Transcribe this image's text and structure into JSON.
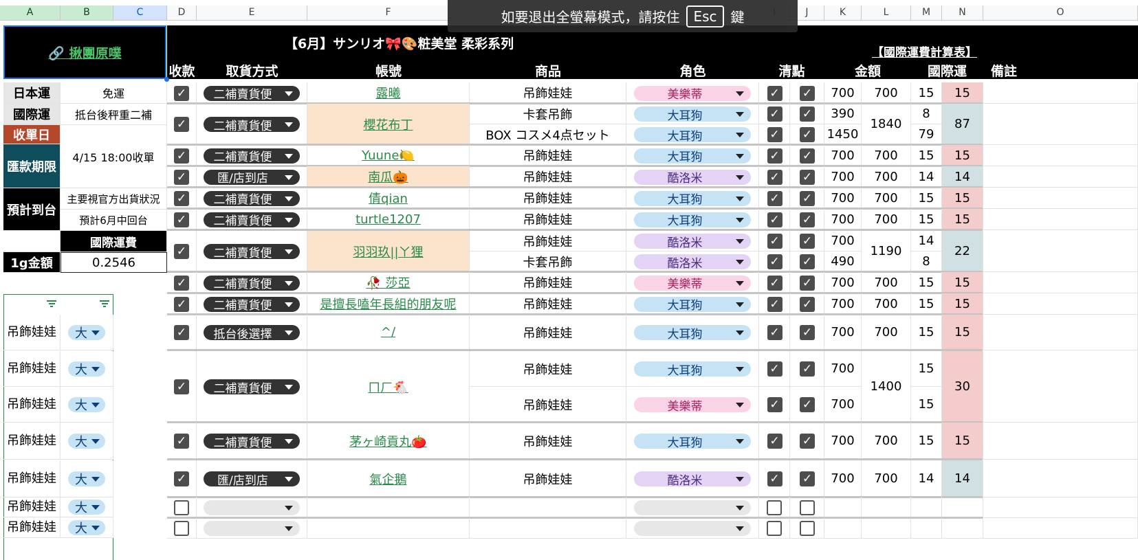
{
  "column_headers": [
    "A",
    "B",
    "C",
    "D",
    "E",
    "F",
    "G",
    "H",
    "I",
    "J",
    "K",
    "L",
    "M",
    "N",
    "O"
  ],
  "toast": {
    "text_before": "如要退出全螢幕模式，請按住",
    "key": "Esc",
    "text_after": "鍵"
  },
  "header": {
    "group_link": "🔗 揪團原噗",
    "title": "【6月】サンリオ🎀🎨粧美堂 柔彩系列",
    "calc_link": "【國際運費計算表】",
    "col_labels": {
      "payment": "收款",
      "pickup": "取貨方式",
      "account": "帳號",
      "product": "商品",
      "character": "角色",
      "check": "清點",
      "amount": "金額",
      "intl_ship": "國際運",
      "note": "備註"
    }
  },
  "info": {
    "jp_ship_label": "日本運",
    "jp_ship_value": "免運",
    "intl_ship_label": "國際運",
    "intl_ship_value": "抵台後秤重二補",
    "close_label": "收單日",
    "close_value": "4/15 18:00收單",
    "pay_label": "匯款期限",
    "arrival_label": "預計到台",
    "arrival_value1": "主要視官方出貨狀況",
    "arrival_value2": "預計6月中回台",
    "intl_fee_label": "國際運費",
    "gram_label": "1g金額",
    "gram_value": "0.2546"
  },
  "filter_rows": [
    {
      "product": "吊飾娃娃",
      "size": "大"
    },
    {
      "product": "吊飾娃娃",
      "size": "大"
    },
    {
      "product": "吊飾娃娃",
      "size": "大"
    },
    {
      "product": "吊飾娃娃",
      "size": "大"
    },
    {
      "product": "吊飾娃娃",
      "size": "大"
    },
    {
      "product": "吊飾娃娃",
      "size": "大"
    },
    {
      "product": "吊飾娃娃",
      "size": "大"
    }
  ],
  "colors": {
    "header_black": "#000000",
    "close_red": "#b5472b",
    "pay_teal": "#0f4c5c",
    "account_peach": "#fbe3cc",
    "ship_pink": "#f4cccc",
    "ship_blue": "#d0e0e3",
    "link_green": "#2a8a4a"
  },
  "orders": [
    {
      "pickup": "二補賣貨便",
      "account": "露曦",
      "account_bg": false,
      "items": [
        {
          "product": "吊飾娃娃",
          "character": "美樂蒂",
          "char_color": "pink",
          "amount": "700",
          "ship": "15"
        }
      ],
      "total": "700",
      "intl": "15",
      "intl_color": "pink"
    },
    {
      "pickup": "二補賣貨便",
      "account": "櫻花布丁",
      "account_bg": true,
      "items": [
        {
          "product": "卡套吊飾",
          "character": "大耳狗",
          "char_color": "blue",
          "amount": "390",
          "ship": "8"
        },
        {
          "product": "BOX コスメ4点セット",
          "character": "大耳狗",
          "char_color": "blue",
          "amount": "1450",
          "ship": "79"
        }
      ],
      "total": "1840",
      "intl": "87",
      "intl_color": "blue"
    },
    {
      "pickup": "二補賣貨便",
      "account": "Yuune🍋",
      "account_bg": false,
      "items": [
        {
          "product": "吊飾娃娃",
          "character": "大耳狗",
          "char_color": "blue",
          "amount": "700",
          "ship": "15"
        }
      ],
      "total": "700",
      "intl": "15",
      "intl_color": "pink"
    },
    {
      "pickup": "匯/店到店",
      "account": "南瓜🎃",
      "account_bg": true,
      "items": [
        {
          "product": "吊飾娃娃",
          "character": "酷洛米",
          "char_color": "purple",
          "amount": "700",
          "ship": "14"
        }
      ],
      "total": "700",
      "intl": "14",
      "intl_color": "blue"
    },
    {
      "pickup": "二補賣貨便",
      "account": "倩qian",
      "account_bg": false,
      "items": [
        {
          "product": "吊飾娃娃",
          "character": "大耳狗",
          "char_color": "blue",
          "amount": "700",
          "ship": "15"
        }
      ],
      "total": "700",
      "intl": "15",
      "intl_color": "pink"
    },
    {
      "pickup": "二補賣貨便",
      "account": "turtle1207",
      "account_bg": false,
      "items": [
        {
          "product": "吊飾娃娃",
          "character": "大耳狗",
          "char_color": "blue",
          "amount": "700",
          "ship": "15"
        }
      ],
      "total": "700",
      "intl": "15",
      "intl_color": "pink"
    },
    {
      "pickup": "二補賣貨便",
      "account": "羽羽玖||ㄚ狸",
      "account_bg": true,
      "items": [
        {
          "product": "吊飾娃娃",
          "character": "酷洛米",
          "char_color": "purple",
          "amount": "700",
          "ship": "14"
        },
        {
          "product": "卡套吊飾",
          "character": "酷洛米",
          "char_color": "purple",
          "amount": "490",
          "ship": "8"
        }
      ],
      "total": "1190",
      "intl": "22",
      "intl_color": "blue"
    },
    {
      "pickup": "二補賣貨便",
      "account": "🥀 莎亞",
      "account_bg": false,
      "items": [
        {
          "product": "吊飾娃娃",
          "character": "美樂蒂",
          "char_color": "pink",
          "amount": "700",
          "ship": "15"
        }
      ],
      "total": "700",
      "intl": "15",
      "intl_color": "pink"
    },
    {
      "pickup": "二補賣貨便",
      "account": "是擅長嗑年長組的朋友呢",
      "account_bg": false,
      "items": [
        {
          "product": "吊飾娃娃",
          "character": "大耳狗",
          "char_color": "blue",
          "amount": "700",
          "ship": "15"
        }
      ],
      "total": "700",
      "intl": "15",
      "intl_color": "pink"
    },
    {
      "pickup": "抵台後選擇",
      "account": "^/",
      "account_bg": false,
      "items": [
        {
          "product": "吊飾娃娃",
          "character": "大耳狗",
          "char_color": "blue",
          "amount": "700",
          "ship": "15"
        }
      ],
      "total": "700",
      "intl": "15",
      "intl_color": "pink"
    },
    {
      "pickup": "二補賣貨便",
      "account": "ㄇㄏ🐔",
      "account_bg": false,
      "items": [
        {
          "product": "吊飾娃娃",
          "character": "大耳狗",
          "char_color": "blue",
          "amount": "700",
          "ship": "15"
        },
        {
          "product": "吊飾娃娃",
          "character": "美樂蒂",
          "char_color": "pink",
          "amount": "700",
          "ship": "15"
        }
      ],
      "total": "1400",
      "intl": "30",
      "intl_color": "pink"
    },
    {
      "pickup": "二補賣貨便",
      "account": "茅ヶ崎貢丸🍅",
      "account_bg": false,
      "items": [
        {
          "product": "吊飾娃娃",
          "character": "大耳狗",
          "char_color": "blue",
          "amount": "700",
          "ship": "15"
        }
      ],
      "total": "700",
      "intl": "15",
      "intl_color": "pink"
    },
    {
      "pickup": "匯/店到店",
      "account": "氣企鵝",
      "account_bg": false,
      "items": [
        {
          "product": "吊飾娃娃",
          "character": "酷洛米",
          "char_color": "purple",
          "amount": "700",
          "ship": "14"
        }
      ],
      "total": "700",
      "intl": "14",
      "intl_color": "blue"
    }
  ]
}
